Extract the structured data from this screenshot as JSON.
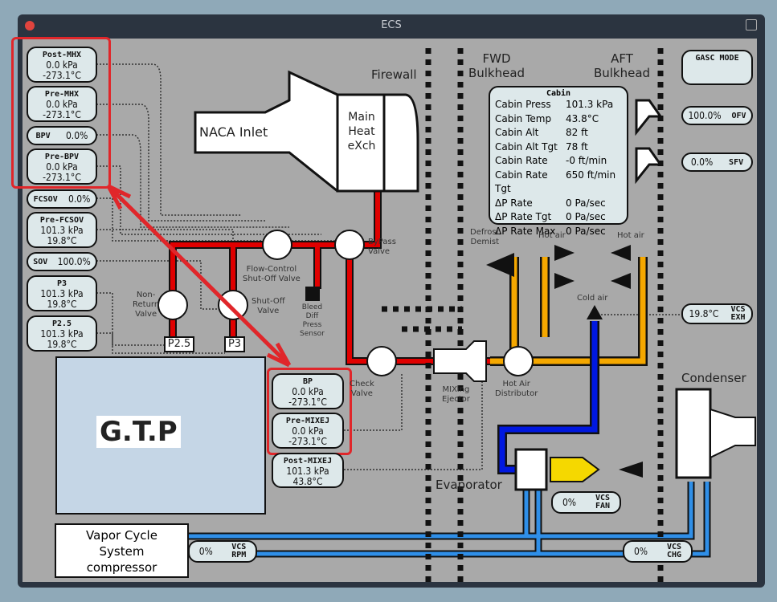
{
  "window": {
    "title": "ECS"
  },
  "left_gauges": [
    {
      "name": "Post-MHX",
      "l1": "0.0 kPa",
      "l2": "-273.1°C"
    },
    {
      "name": "Pre-MHX",
      "l1": "0.0 kPa",
      "l2": "-273.1°C"
    },
    {
      "name": "BPV",
      "value": "0.0%"
    },
    {
      "name": "Pre-BPV",
      "l1": "0.0 kPa",
      "l2": "-273.1°C"
    },
    {
      "name": "FCSOV",
      "value": "0.0%"
    },
    {
      "name": "Pre-FCSOV",
      "l1": "101.3 kPa",
      "l2": "19.8°C"
    },
    {
      "name": "SOV",
      "value": "100.0%"
    },
    {
      "name": "P3",
      "l1": "101.3 kPa",
      "l2": "19.8°C"
    },
    {
      "name": "P2.5",
      "l1": "101.3 kPa",
      "l2": "19.8°C"
    }
  ],
  "mid_gauges": [
    {
      "name": "BP",
      "l1": "0.0 kPa",
      "l2": "-273.1°C"
    },
    {
      "name": "Pre-MIXEJ",
      "l1": "0.0 kPa",
      "l2": "-273.1°C"
    },
    {
      "name": "Post-MIXEJ",
      "l1": "101.3 kPa",
      "l2": "43.8°C"
    }
  ],
  "right_gauges": {
    "gasc": "GASC MODE",
    "ofv": {
      "value": "100.0%",
      "name": "OFV"
    },
    "sfv": {
      "value": "0.0%",
      "name": "SFV"
    },
    "vcs_exh": {
      "value": "19.8°C",
      "name1": "VCS",
      "name2": "EXH"
    }
  },
  "bottom_gauges": {
    "fan": {
      "value": "0%",
      "n1": "VCS",
      "n2": "FAN"
    },
    "rpm": {
      "value": "0%",
      "n1": "VCS",
      "n2": "RPM"
    },
    "chg": {
      "value": "0%",
      "n1": "VCS",
      "n2": "CHG"
    }
  },
  "cabin": {
    "title": "Cabin",
    "rows": [
      [
        "Cabin Press",
        "101.3 kPa"
      ],
      [
        "Cabin Temp",
        "43.8°C"
      ],
      [
        "Cabin Alt",
        "82 ft"
      ],
      [
        "Cabin Alt Tgt",
        "78 ft"
      ],
      [
        "Cabin Rate",
        "-0 ft/min"
      ],
      [
        "Cabin Rate Tgt",
        "650 ft/min"
      ],
      [
        "ΔP Rate",
        "0 Pa/sec"
      ],
      [
        "ΔP Rate Tgt",
        "0 Pa/sec"
      ],
      [
        "ΔP Rate Max",
        "0 Pa/sec"
      ]
    ]
  },
  "labels": {
    "firewall": "Firewall",
    "fwd": "FWD",
    "fwd2": "Bulkhead",
    "aft": "AFT",
    "aft2": "Bulkhead",
    "naca": "NACA Inlet",
    "mhx1": "Main",
    "mhx2": "Heat",
    "mhx3": "eXch",
    "bypass1": "ByPass",
    "bypass2": "Valve",
    "fcsov1": "Flow-Control",
    "fcsov2": "Shut-Off Valve",
    "nonret1": "Non-",
    "nonret2": "Return",
    "nonret3": "Valve",
    "sov1": "Shut-Off",
    "sov2": "Valve",
    "bleed1": "Bleed",
    "bleed2": "Diff",
    "bleed3": "Press",
    "bleed4": "Sensor",
    "p25": "P2.5",
    "p3": "P3",
    "gtp": "G.T.P",
    "check1": "Check",
    "check2": "Valve",
    "mix1": "MIXing",
    "mix2": "Ejector",
    "had1": "Hot Air",
    "had2": "Distributor",
    "defrost1": "Defrost",
    "defrost2": "Demist",
    "hot1": "Hot air",
    "hot2": "Hot air",
    "cold": "Cold air",
    "condenser": "Condenser",
    "evaporator": "Evaporator",
    "vcs1": "Vapor Cycle",
    "vcs2": "System",
    "vcs3": "compressor"
  },
  "colors": {
    "bleed": "#e00000",
    "hot": "#f5a800",
    "cold": "#0018e0",
    "refrigerant": "#2f8fe8",
    "highlight": "#e0262a",
    "panel": "#a9a9a9"
  }
}
